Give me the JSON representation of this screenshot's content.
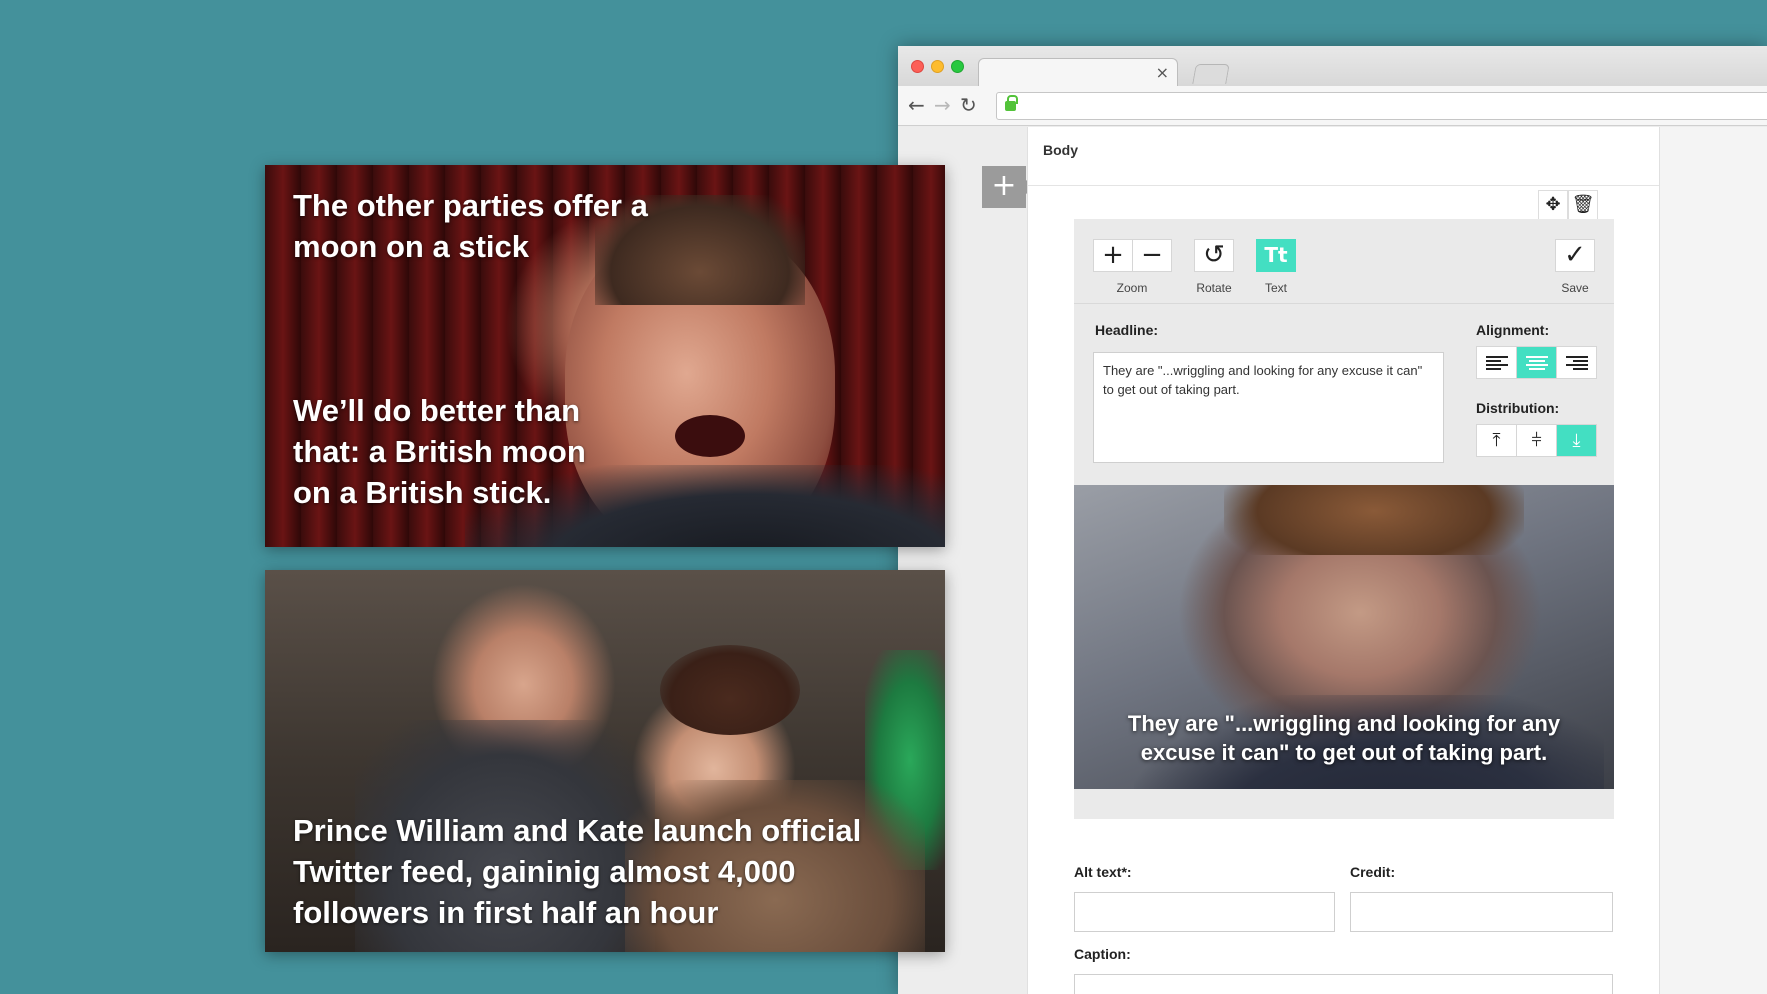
{
  "cards": [
    {
      "top_text": "The other parties offer a moon on a stick",
      "bottom_text": "We’ll do better than that: a British moon on a British stick."
    },
    {
      "bottom_text": "Prince William and Kate launch official Twitter feed, gaininig almost 4,000 followers in first half an hour"
    }
  ],
  "browser": {
    "tab_close": "×",
    "nav": {
      "back": "←",
      "forward": "→",
      "reload": "↻"
    }
  },
  "editor": {
    "section_label": "Body",
    "add_symbol": "+",
    "move_symbol": "✥",
    "trash_symbol": "🗑",
    "toolbar": {
      "zoom_in_symbol": "+",
      "zoom_out_symbol": "−",
      "rotate_symbol": "↺",
      "text_symbol": "Tt",
      "save_symbol": "✓",
      "zoom_label": "Zoom",
      "rotate_label": "Rotate",
      "text_label": "Text",
      "save_label": "Save",
      "accent_color": "#43dfc2"
    },
    "headline_label": "Headline:",
    "headline_value": "They are \"...wriggling and looking for any excuse it can\" to get out of taking part.",
    "alignment_label": "Alignment:",
    "alignment_selected": "center",
    "distribution_label": "Distribution:",
    "distribution_selected": "bottom",
    "distribution_symbols": {
      "top": "⤒",
      "middle": "⫩",
      "bottom": "⤓"
    },
    "preview_caption": "They are \"...wriggling and looking for any excuse it can\" to get out of taking part.",
    "alt_text_label": "Alt text*:",
    "credit_label": "Credit:",
    "caption_label": "Caption:"
  }
}
